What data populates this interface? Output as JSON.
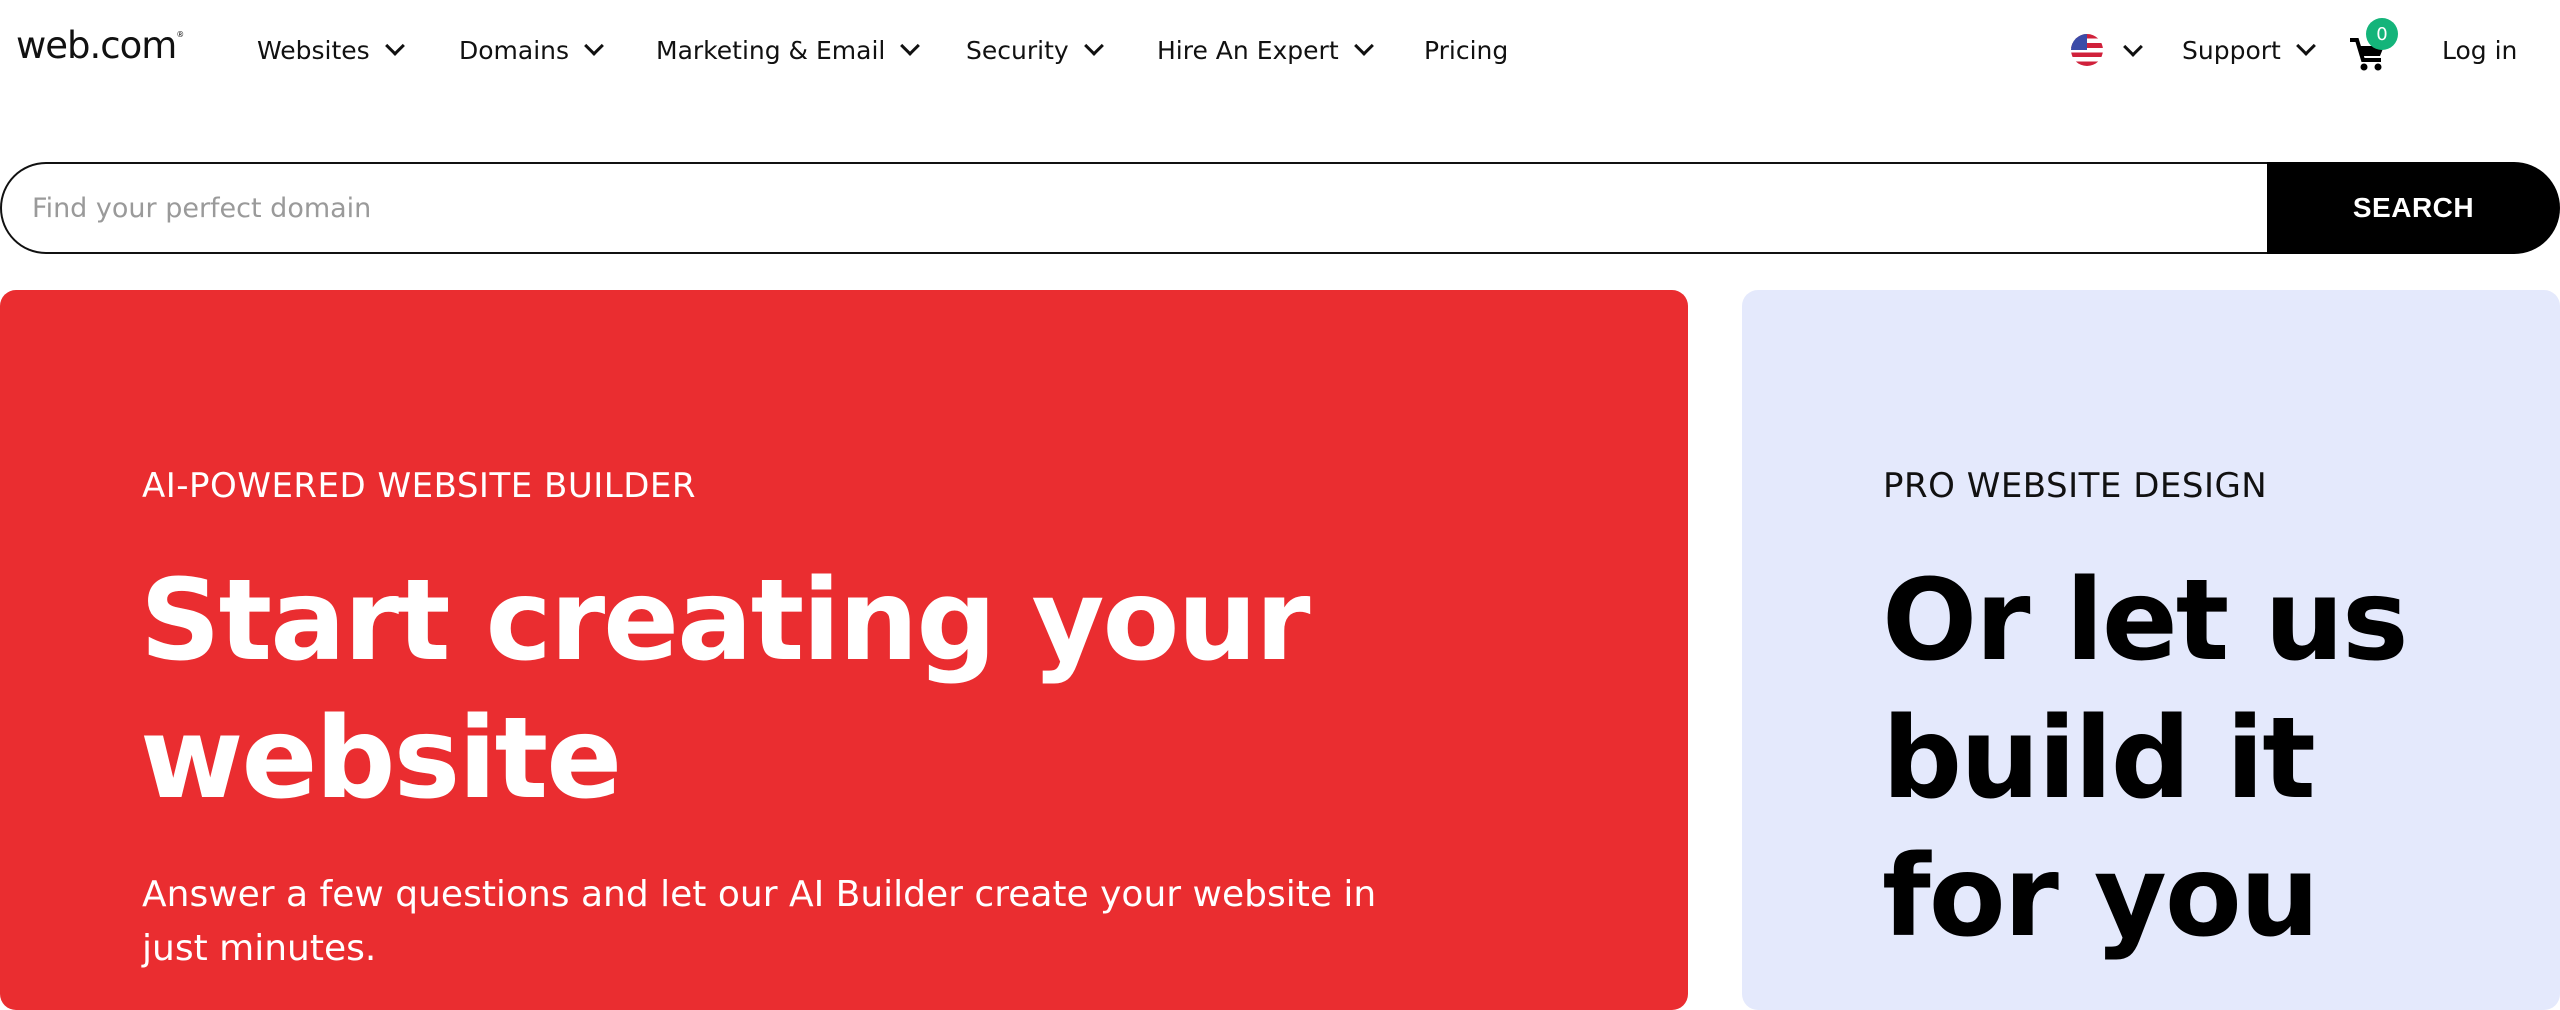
{
  "header": {
    "logo": "web.com",
    "logo_mark": "®",
    "nav": [
      {
        "label": "Websites",
        "has_dropdown": true
      },
      {
        "label": "Domains",
        "has_dropdown": true
      },
      {
        "label": "Marketing & Email",
        "has_dropdown": true
      },
      {
        "label": "Security",
        "has_dropdown": true
      },
      {
        "label": "Hire An Expert",
        "has_dropdown": true
      },
      {
        "label": "Pricing",
        "has_dropdown": false
      }
    ],
    "locale_icon": "us-flag-icon",
    "support_label": "Support",
    "cart_icon": "cart-icon",
    "cart_count": "0",
    "login_label": "Log in"
  },
  "search": {
    "placeholder": "Find your perfect domain",
    "value": "",
    "button_label": "SEARCH"
  },
  "hero_left": {
    "eyebrow": "AI-POWERED WEBSITE BUILDER",
    "headline_line1": "Start creating your",
    "headline_line2": "website",
    "subtext": "Answer a few questions and let our AI Builder create your website in just minutes.",
    "bg_color": "#ea2d30"
  },
  "hero_right": {
    "eyebrow": "PRO WEBSITE DESIGN",
    "headline_line1": "Or let us",
    "headline_line2": "build it",
    "headline_line3": "for you",
    "bg_color": "#e4e9fc"
  },
  "colors": {
    "cart_badge": "#14b47a",
    "search_button": "#000000"
  }
}
